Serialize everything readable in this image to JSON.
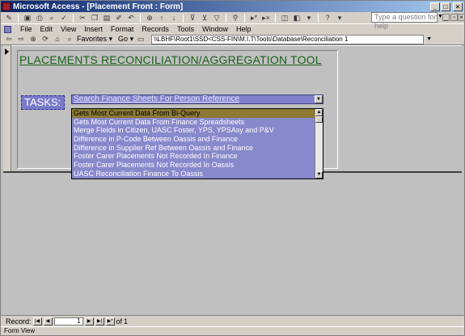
{
  "window": {
    "title": "Microsoft Access - [Placement Front : Form]"
  },
  "help": {
    "placeholder": "Type a question for help"
  },
  "menu": {
    "items": [
      "File",
      "Edit",
      "View",
      "Insert",
      "Format",
      "Records",
      "Tools",
      "Window",
      "Help"
    ]
  },
  "nav": {
    "favorites_label": "Favorites",
    "go_label": "Go",
    "address": "\\\\LBHF\\Root1\\SSD<CSS-FIN\\M.I.T\\Tools\\Database\\Reconciliation 1"
  },
  "form": {
    "heading": "PLACEMENTS RECONCILIATION/AGGREGATION TOOL",
    "tasks_label": "TASKS:",
    "combo_value": "Search Finance Sheets For Person Reference",
    "options": [
      "Gets Most Current Data From Bi-Query",
      "Gets Most Current Data From Finance Spreadsheets",
      "Merge Fields in Citizen, UASC Foster, YPS, YPSAsy and P&V",
      "Difference in P-Code Between Oassis and Finance",
      "Difference in Supplier Ref Between Oassis and Finance",
      "Foster Carer Placements Not Recorded In Finance",
      "Foster Carer Placements Not Recorded In Oassis",
      "UASC Reconciliation Finance To Oassis"
    ],
    "selected_index": 0
  },
  "record_nav": {
    "label": "Record:",
    "current": "1",
    "of_label": "of",
    "total": "1"
  },
  "status": {
    "text": "Form View"
  },
  "colors": {
    "title_gradient_start": "#0a246a",
    "heading_green": "#1a5f1a",
    "combo_purple": "#8080cc",
    "selection_olive": "#8c7a34"
  }
}
